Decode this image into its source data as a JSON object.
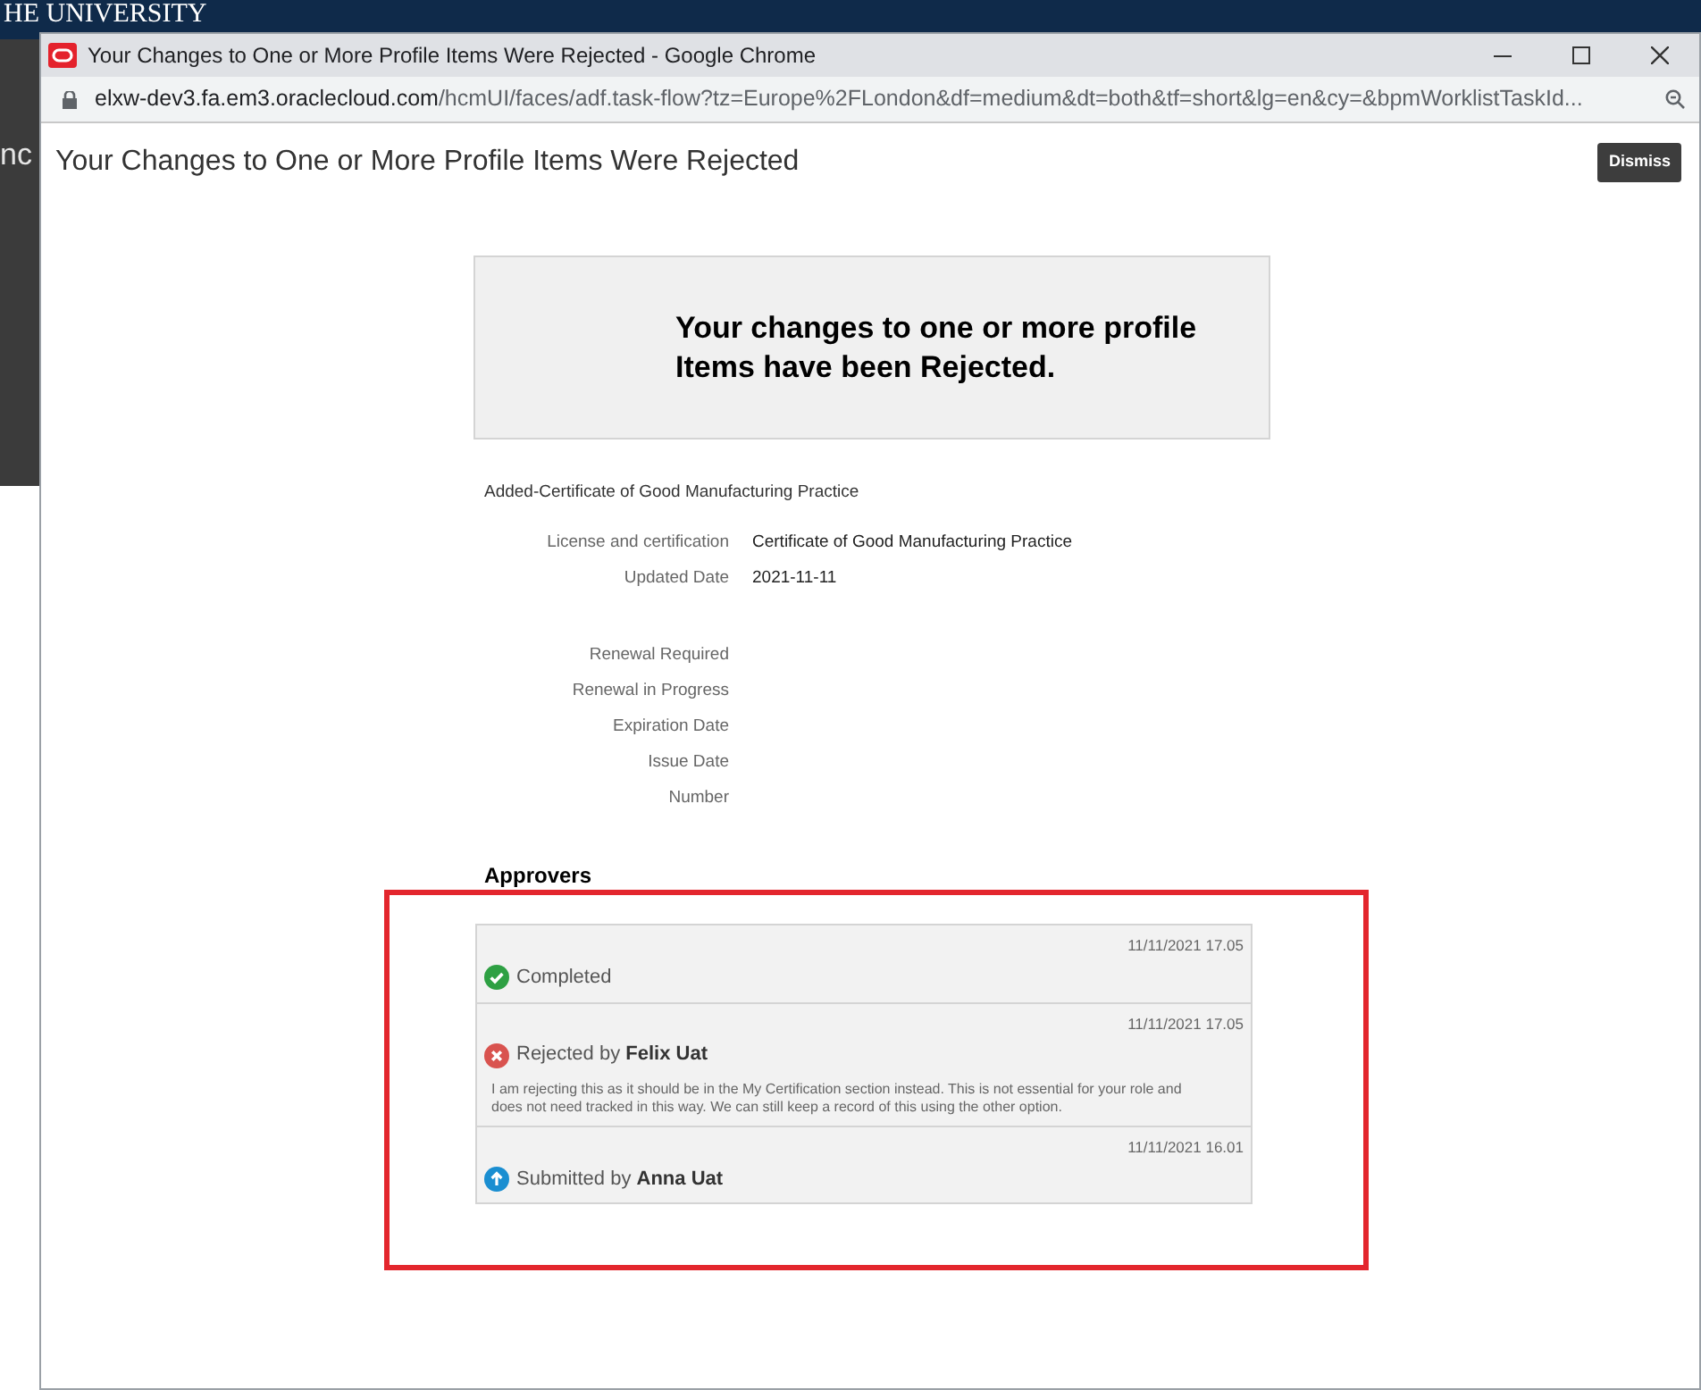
{
  "background": {
    "logo_text": "HE UNIVERSITY",
    "side_text": "nc"
  },
  "window": {
    "title": "Your Changes to One or More Profile Items Were Rejected - Google Chrome",
    "address": {
      "host": "elxw-dev3.fa.em3.oraclecloud.com",
      "path": "/hcmUI/faces/adf.task-flow?tz=Europe%2FLondon&df=medium&dt=both&tf=short&lg=en&cy=&bpmWorklistTaskId..."
    }
  },
  "page": {
    "title": "Your Changes to One or More Profile Items Were Rejected",
    "dismiss": "Dismiss"
  },
  "banner": "Your changes to one or more profile Items have been Rejected.",
  "item_heading": "Added-Certificate of Good Manufacturing Practice",
  "fields": [
    {
      "label": "License and certification",
      "value": "Certificate of Good Manufacturing Practice"
    },
    {
      "label": "Updated Date",
      "value": "2021-11-11"
    }
  ],
  "empty_fields": [
    "Renewal Required",
    "Renewal in Progress",
    "Expiration Date",
    "Issue Date",
    "Number"
  ],
  "approvers": {
    "heading": "Approvers",
    "entries": [
      {
        "kind": "completed",
        "time": "11/11/2021 17.05",
        "text": "Completed"
      },
      {
        "kind": "rejected",
        "time": "11/11/2021 17.05",
        "text": "Rejected by **Felix Uat**",
        "comment": "I am rejecting this as it should be in the My Certification section instead. This is not essential for your role and does not need tracked in this way. We can still keep a record of this using the other option."
      },
      {
        "kind": "submitted",
        "time": "11/11/2021 16.01",
        "text": "Submitted by **Anna Uat**"
      }
    ]
  }
}
